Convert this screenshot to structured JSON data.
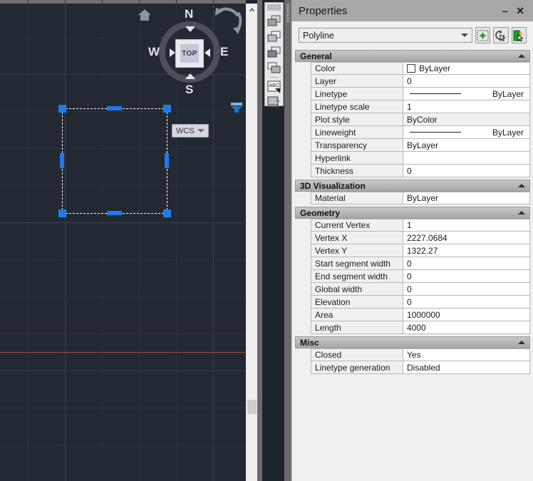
{
  "canvas": {
    "viewcube": {
      "face_label": "TOP",
      "north": "N",
      "east": "E",
      "south": "S",
      "west": "W",
      "home_icon": "home-icon",
      "rotate_icon": "rotate-arrows-icon"
    },
    "ucs_badge": {
      "label": "WCS"
    },
    "nav_filter_icon": "nav-filter-icon",
    "axis_color": "#9e4a4a",
    "grid_color": "#2c333e",
    "background": "#232932",
    "grip_color": "#1f7bed",
    "selection": {
      "name": "selected-polyline",
      "corner_grips": 4,
      "midpoint_grips": 4
    },
    "scrollbar": {
      "up_arrow_icon": "chevron-up-icon"
    }
  },
  "toolbar": {
    "name": "layers-toolbar",
    "buttons": [
      {
        "icon": "layer-previous-icon"
      },
      {
        "icon": "layer-isolate-icon"
      },
      {
        "icon": "layer-freeze-icon"
      },
      {
        "icon": "layer-off-icon"
      },
      {
        "icon": "text-abc-icon"
      },
      {
        "icon": "layer-merge-icon"
      }
    ]
  },
  "properties": {
    "title": "Properties",
    "minimize_label": "–",
    "close_label": "✕",
    "object_type": "Polyline",
    "tools": [
      {
        "name": "quick-select-button",
        "icon": "dotted-square-plus-icon"
      },
      {
        "name": "select-objects-button",
        "icon": "cursor-refresh-icon"
      },
      {
        "name": "quick-select-filter-button",
        "icon": "door-lightning-icon"
      }
    ],
    "sections": [
      {
        "title": "General",
        "rows": [
          {
            "name": "Color",
            "value": "ByLayer",
            "swatch": true
          },
          {
            "name": "Layer",
            "value": "0"
          },
          {
            "name": "Linetype",
            "value": "ByLayer",
            "line": true
          },
          {
            "name": "Linetype scale",
            "value": "1"
          },
          {
            "name": "Plot style",
            "value": "ByColor",
            "readonly": true
          },
          {
            "name": "Lineweight",
            "value": "ByLayer",
            "line": true
          },
          {
            "name": "Transparency",
            "value": "ByLayer"
          },
          {
            "name": "Hyperlink",
            "value": ""
          },
          {
            "name": "Thickness",
            "value": "0"
          }
        ]
      },
      {
        "title": "3D Visualization",
        "rows": [
          {
            "name": "Material",
            "value": "ByLayer"
          }
        ]
      },
      {
        "title": "Geometry",
        "rows": [
          {
            "name": "Current Vertex",
            "value": "1"
          },
          {
            "name": "Vertex X",
            "value": "2227.0684"
          },
          {
            "name": "Vertex Y",
            "value": "1322.27"
          },
          {
            "name": "Start segment width",
            "value": "0"
          },
          {
            "name": "End segment width",
            "value": "0"
          },
          {
            "name": "Global width",
            "value": "0"
          },
          {
            "name": "Elevation",
            "value": "0"
          },
          {
            "name": "Area",
            "value": "1000000"
          },
          {
            "name": "Length",
            "value": "4000"
          }
        ]
      },
      {
        "title": "Misc",
        "rows": [
          {
            "name": "Closed",
            "value": "Yes"
          },
          {
            "name": "Linetype generation",
            "value": "Disabled"
          }
        ]
      }
    ]
  }
}
